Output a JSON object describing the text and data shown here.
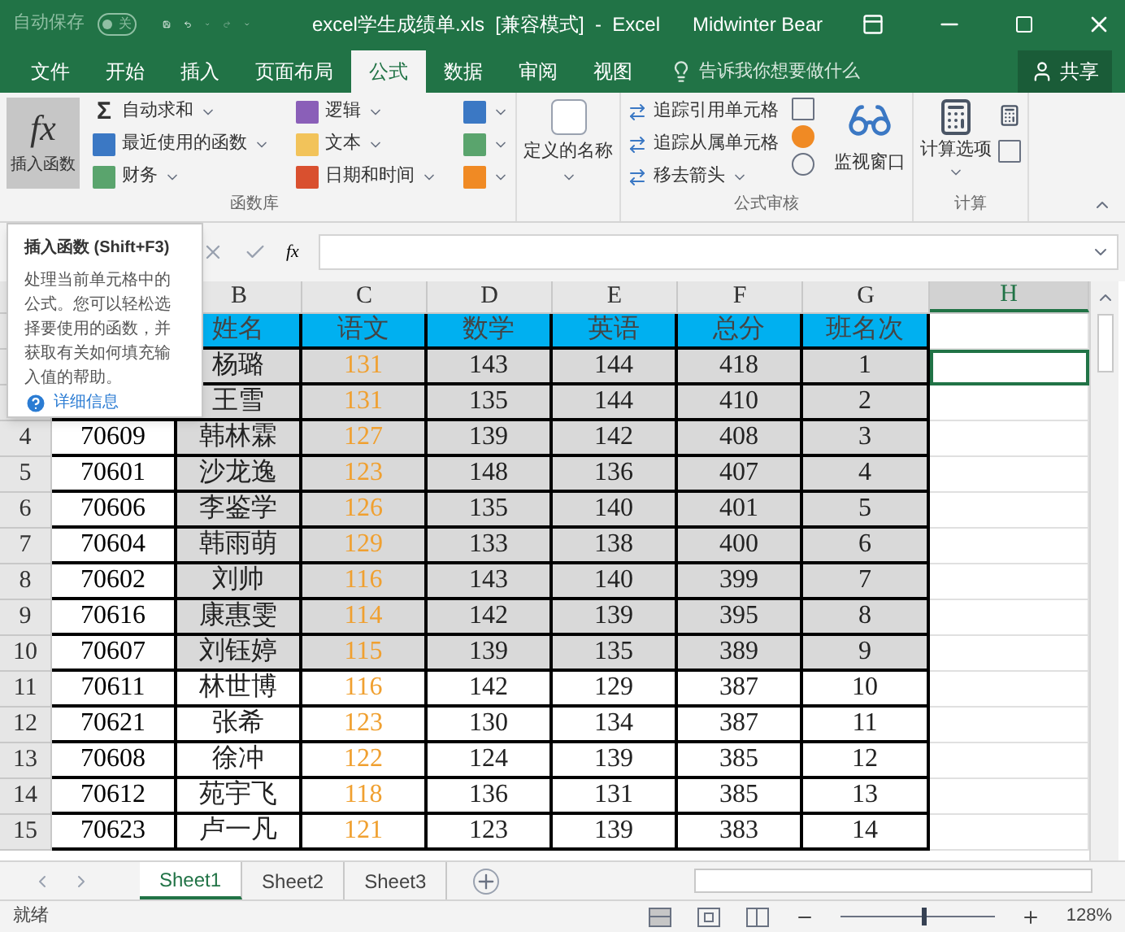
{
  "title_bar": {
    "autosave": {
      "label": "自动保存",
      "on": false,
      "state_label": "关"
    },
    "title": "excel学生成绩单.xls  [兼容模式]  -  Excel",
    "user": "Midwinter Bear"
  },
  "tabs": [
    {
      "label": "文件",
      "selected": false
    },
    {
      "label": "开始",
      "selected": false
    },
    {
      "label": "插入",
      "selected": false
    },
    {
      "label": "页面布局",
      "selected": false
    },
    {
      "label": "公式",
      "selected": true
    },
    {
      "label": "数据",
      "selected": false
    },
    {
      "label": "审阅",
      "selected": false
    },
    {
      "label": "视图",
      "selected": false
    }
  ],
  "tell_me": "告诉我你想要做什么",
  "share": "共享",
  "ribbon": {
    "insert_function": {
      "icon": "fx",
      "label": "插入函数",
      "selected": true
    },
    "sum_symbol": "Σ",
    "library_col1": [
      "自动求和",
      "最近使用的函数",
      "财务"
    ],
    "library_col2": [
      "逻辑",
      "文本",
      "日期和时间"
    ],
    "library_label": "函数库",
    "defined_names": "定义的名称",
    "audit_col": [
      "追踪引用单元格",
      "追踪从属单元格",
      "移去箭头"
    ],
    "watch": "监视窗口",
    "audit_label": "公式审核",
    "calc_options": "计算选项",
    "calc_label": "计算"
  },
  "formula_fx": "fx",
  "tooltip": {
    "title": "插入函数 (Shift+F3)",
    "body": "处理当前单元格中的公式。您可以轻松选择要使用的函数，并获取有关如何填充输入值的帮助。",
    "link": "详细信息"
  },
  "columns": [
    {
      "label": "B",
      "selected": false
    },
    {
      "label": "C",
      "selected": false
    },
    {
      "label": "D",
      "selected": false
    },
    {
      "label": "E",
      "selected": false
    },
    {
      "label": "F",
      "selected": false
    },
    {
      "label": "G",
      "selected": false
    },
    {
      "label": "H",
      "selected": true
    }
  ],
  "rows": [
    {
      "kind": "heading",
      "cells": [
        "姓名",
        "语文",
        "数学",
        "英语",
        "总分",
        "班名次"
      ],
      "h_selected": false
    },
    {
      "kind": "data",
      "cells": [
        "杨璐",
        "131",
        "143",
        "144",
        "418",
        "1"
      ],
      "highlighted": true,
      "h_selected": true
    },
    {
      "kind": "data",
      "cells": [
        "王雪",
        "131",
        "135",
        "144",
        "410",
        "2"
      ],
      "highlighted": true,
      "h_selected": false
    },
    {
      "kind": "data",
      "row": "4",
      "id": "70609",
      "cells": [
        "韩林霖",
        "127",
        "139",
        "142",
        "408",
        "3"
      ],
      "highlighted": true,
      "h_selected": false
    },
    {
      "kind": "data",
      "row": "5",
      "id": "70601",
      "cells": [
        "沙龙逸",
        "123",
        "148",
        "136",
        "407",
        "4"
      ],
      "highlighted": true,
      "h_selected": false
    },
    {
      "kind": "data",
      "row": "6",
      "id": "70606",
      "cells": [
        "李鉴学",
        "126",
        "135",
        "140",
        "401",
        "5"
      ],
      "highlighted": true,
      "h_selected": false
    },
    {
      "kind": "data",
      "row": "7",
      "id": "70604",
      "cells": [
        "韩雨萌",
        "129",
        "133",
        "138",
        "400",
        "6"
      ],
      "highlighted": true,
      "h_selected": false
    },
    {
      "kind": "data",
      "row": "8",
      "id": "70602",
      "cells": [
        "刘帅",
        "116",
        "143",
        "140",
        "399",
        "7"
      ],
      "highlighted": true,
      "h_selected": false
    },
    {
      "kind": "data",
      "row": "9",
      "id": "70616",
      "cells": [
        "康惠雯",
        "114",
        "142",
        "139",
        "395",
        "8"
      ],
      "highlighted": true,
      "h_selected": false
    },
    {
      "kind": "data",
      "row": "10",
      "id": "70607",
      "cells": [
        "刘钰婷",
        "115",
        "139",
        "135",
        "389",
        "9"
      ],
      "highlighted": true,
      "h_selected": false
    },
    {
      "kind": "data",
      "row": "11",
      "id": "70611",
      "cells": [
        "林世博",
        "116",
        "142",
        "129",
        "387",
        "10"
      ],
      "highlighted": false,
      "h_selected": false
    },
    {
      "kind": "data",
      "row": "12",
      "id": "70621",
      "cells": [
        "张希",
        "123",
        "130",
        "134",
        "387",
        "11"
      ],
      "highlighted": false,
      "h_selected": false
    },
    {
      "kind": "data",
      "row": "13",
      "id": "70608",
      "cells": [
        "徐冲",
        "122",
        "124",
        "139",
        "385",
        "12"
      ],
      "highlighted": false,
      "h_selected": false
    },
    {
      "kind": "data",
      "row": "14",
      "id": "70612",
      "cells": [
        "苑宇飞",
        "118",
        "136",
        "131",
        "385",
        "13"
      ],
      "highlighted": false,
      "h_selected": false
    },
    {
      "kind": "data",
      "row": "15",
      "id": "70623",
      "cells": [
        "卢一凡",
        "121",
        "123",
        "139",
        "383",
        "14"
      ],
      "highlighted": false,
      "h_selected": false
    }
  ],
  "sheets": [
    {
      "label": "Sheet1",
      "selected": true
    },
    {
      "label": "Sheet2",
      "selected": false
    },
    {
      "label": "Sheet3",
      "selected": false
    }
  ],
  "status": {
    "text": "就绪",
    "views": [
      {
        "kind": "normal",
        "selected": true
      },
      {
        "kind": "layout",
        "selected": false
      },
      {
        "kind": "pagebreak",
        "selected": false
      }
    ],
    "zoom": {
      "level": 0.53,
      "reading": "128%"
    }
  }
}
